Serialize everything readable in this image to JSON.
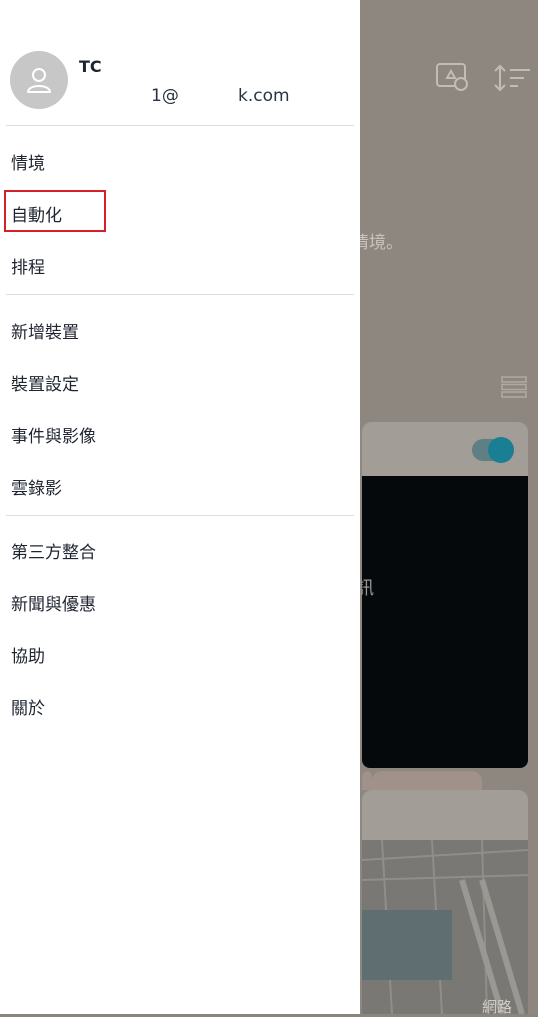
{
  "background": {
    "partial_scene_text": "情境。",
    "partial_message_text": "訊",
    "partial_bottom_text": "網路"
  },
  "user": {
    "name": "TC",
    "email_part1": "1@",
    "email_part2": "k.com"
  },
  "menu": {
    "group1": [
      "情境",
      "自動化",
      "排程"
    ],
    "group2": [
      "新增裝置",
      "裝置設定",
      "事件與影像",
      "雲錄影"
    ],
    "group3": [
      "第三方整合",
      "新聞與優惠",
      "協助",
      "關於"
    ]
  },
  "colors": {
    "highlight_border": "#d32029",
    "toggle_knob": "#1a7f95"
  }
}
